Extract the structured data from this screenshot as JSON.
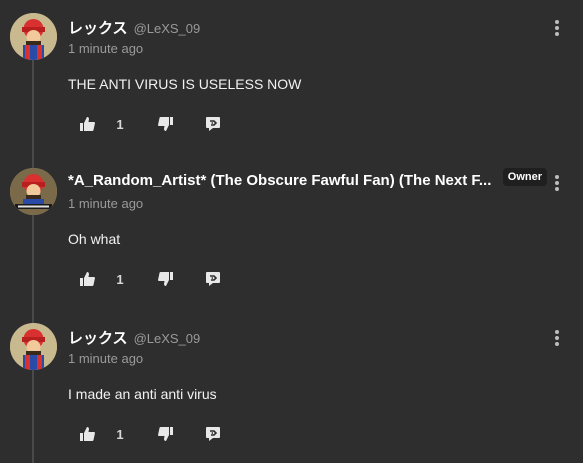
{
  "comments": [
    {
      "author": "レックス",
      "handle": "@LeXS_09",
      "time": "1 minute ago",
      "text": "THE ANTI VIRUS IS USELESS NOW",
      "likes": "1",
      "badge": ""
    },
    {
      "author": "*A_Random_Artist* (The Obscure Fawful Fan) (The Next F...",
      "handle": "",
      "time": "1 minute ago",
      "text": "Oh what",
      "likes": "1",
      "badge": "Owner"
    },
    {
      "author": "レックス",
      "handle": "@LeXS_09",
      "time": "1 minute ago",
      "text": "I made an anti anti virus",
      "likes": "1",
      "badge": ""
    }
  ],
  "icons": {
    "like": "thumbs-up-icon",
    "dislike": "thumbs-down-icon",
    "reply": "reply-icon",
    "more": "more-vertical-icon"
  },
  "colors": {
    "background": "#2e2e2e",
    "thread_line": "#4a4a4a",
    "muted_text": "#9a9a9a",
    "badge_bg": "#1f1f1f"
  }
}
